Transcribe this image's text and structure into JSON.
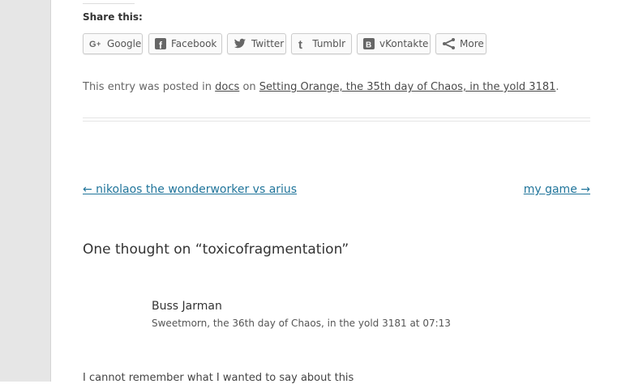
{
  "share": {
    "heading": "Share this:",
    "buttons": [
      {
        "label": "Google",
        "icon": "google-plus-icon"
      },
      {
        "label": "Facebook",
        "icon": "facebook-icon"
      },
      {
        "label": "Twitter",
        "icon": "twitter-icon"
      },
      {
        "label": "Tumblr",
        "icon": "tumblr-icon"
      },
      {
        "label": "vKontakte",
        "icon": "vkontakte-icon"
      },
      {
        "label": "More",
        "icon": "share-icon"
      }
    ]
  },
  "entry_meta": {
    "prefix": "This entry was posted in",
    "category": "docs",
    "middle": "on",
    "date": "Setting Orange, the 35th day of Chaos, in the yold 3181",
    "suffix": "."
  },
  "post_nav": {
    "prev": "← nikolaos the wonderworker vs arius",
    "next": "my game →"
  },
  "comments": {
    "title": "One thought on “toxicofragmentation”",
    "items": [
      {
        "author": "Buss Jarman",
        "date": "Sweetmorn, the 36th day of Chaos, in the yold 3181 at 07:13",
        "text": "I cannot remember what I wanted to say about this"
      }
    ]
  }
}
